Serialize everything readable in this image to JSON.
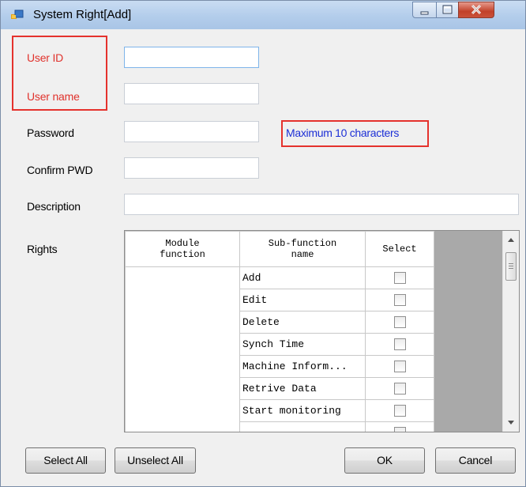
{
  "window": {
    "title": "System Right[Add]",
    "controls": [
      "minimize",
      "maximize",
      "close"
    ],
    "icon": "app-icon"
  },
  "form": {
    "user_id": {
      "label": "User ID",
      "value": ""
    },
    "user_name": {
      "label": "User name",
      "value": ""
    },
    "password": {
      "label": "Password",
      "value": "",
      "hint": "Maximum 10 characters"
    },
    "confirm_pwd": {
      "label": "Confirm PWD",
      "value": ""
    },
    "description": {
      "label": "Description",
      "value": ""
    },
    "rights_label": "Rights"
  },
  "rights_table": {
    "columns": [
      "Module function",
      "Sub-function name",
      "Select"
    ],
    "rows": [
      {
        "module": "",
        "sub_function": "Add",
        "selected": false
      },
      {
        "module": "",
        "sub_function": "Edit",
        "selected": false
      },
      {
        "module": "",
        "sub_function": "Delete",
        "selected": false
      },
      {
        "module": "",
        "sub_function": "Synch Time",
        "selected": false
      },
      {
        "module": "",
        "sub_function": "Machine Inform...",
        "selected": false
      },
      {
        "module": "",
        "sub_function": "Retrive Data",
        "selected": false
      },
      {
        "module": "",
        "sub_function": "Start monitoring",
        "selected": false
      },
      {
        "module": "",
        "sub_function": "",
        "selected": false
      }
    ]
  },
  "buttons": {
    "select_all": "Select All",
    "unselect_all": "Unselect All",
    "ok": "OK",
    "cancel": "Cancel"
  },
  "colors": {
    "highlight_box": "#e5322d",
    "required_label": "#e0322c",
    "hint_text": "#1c2fd6"
  }
}
